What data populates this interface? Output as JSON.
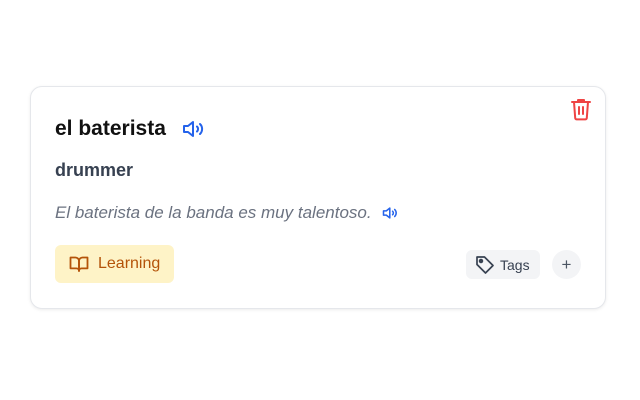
{
  "card": {
    "word": "el baterista",
    "translation": "drummer",
    "example": "El baterista de la banda es muy talentoso.",
    "status_label": "Learning",
    "tags_label": "Tags",
    "add_label": "+"
  },
  "icons": {
    "delete": "trash-icon",
    "speak_word": "speaker-icon",
    "speak_example": "speaker-icon",
    "status": "book-open-icon",
    "tags": "tag-icon"
  },
  "colors": {
    "accent_blue": "#2563eb",
    "delete_red": "#ef4444",
    "status_bg": "#fef3c7",
    "status_text": "#b45309"
  }
}
